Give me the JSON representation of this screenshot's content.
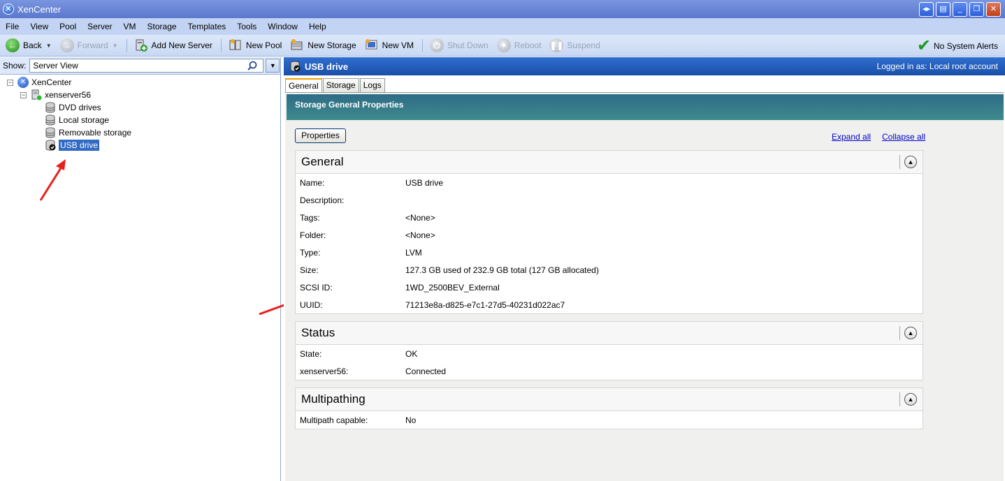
{
  "window": {
    "title": "XenCenter"
  },
  "menu": [
    "File",
    "View",
    "Pool",
    "Server",
    "VM",
    "Storage",
    "Templates",
    "Tools",
    "Window",
    "Help"
  ],
  "toolbar": {
    "back": "Back",
    "forward": "Forward",
    "add_new_server": "Add New Server",
    "new_pool": "New Pool",
    "new_storage": "New Storage",
    "new_vm": "New VM",
    "shut_down": "Shut Down",
    "reboot": "Reboot",
    "suspend": "Suspend",
    "alerts": "No System Alerts"
  },
  "left": {
    "show_label": "Show:",
    "show_value": "Server View",
    "tree": {
      "root": "XenCenter",
      "server": "xenserver56",
      "items": [
        "DVD drives",
        "Local storage",
        "Removable storage",
        "USB drive"
      ]
    }
  },
  "right": {
    "header_title": "USB drive",
    "logged_in": "Logged in as:  Local root account",
    "tabs": [
      "General",
      "Storage",
      "Logs"
    ],
    "banner": "Storage General Properties",
    "properties_button": "Properties",
    "expand_all": "Expand all",
    "collapse_all": "Collapse all",
    "general": {
      "title": "General",
      "rows": [
        {
          "k": "Name:",
          "v": "USB drive"
        },
        {
          "k": "Description:",
          "v": ""
        },
        {
          "k": "Tags:",
          "v": "<None>"
        },
        {
          "k": "Folder:",
          "v": "<None>"
        },
        {
          "k": "Type:",
          "v": "LVM"
        },
        {
          "k": "Size:",
          "v": "127.3 GB used of 232.9 GB total (127 GB allocated)"
        },
        {
          "k": "SCSI ID:",
          "v": "1WD_2500BEV_External"
        },
        {
          "k": "UUID:",
          "v": "71213e8a-d825-e7c1-27d5-40231d022ac7"
        }
      ]
    },
    "status": {
      "title": "Status",
      "rows": [
        {
          "k": "State:",
          "v": "OK"
        },
        {
          "k": "xenserver56:",
          "v": "Connected"
        }
      ]
    },
    "multipathing": {
      "title": "Multipathing",
      "rows": [
        {
          "k": "Multipath capable:",
          "v": "No"
        }
      ]
    }
  },
  "colors": {
    "title_bar": "#6a86d6",
    "menu_bar": "#c2d3f3",
    "header_bar": "#1f5bb8",
    "banner": "#357a8a",
    "selection": "#316ac5",
    "annotation_arrow": "#e8201a"
  }
}
